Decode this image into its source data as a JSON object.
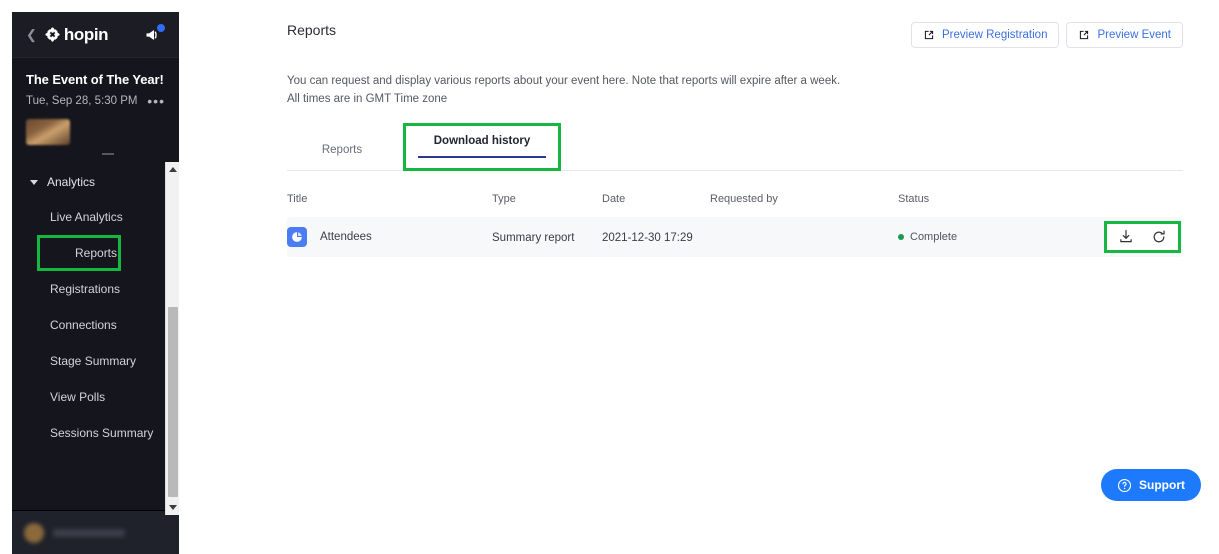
{
  "sidebar": {
    "back_icon": "chevron-left-icon",
    "brand": "hopin",
    "notification_icon": "megaphone-icon",
    "event": {
      "title": "The Event of The Year!",
      "datetime": "Tue, Sep 28, 5:30 PM",
      "more_label": "•••"
    },
    "nav_group": {
      "label": "Analytics",
      "expanded": true
    },
    "items": [
      {
        "label": "Live Analytics",
        "highlighted": false
      },
      {
        "label": "Reports",
        "highlighted": true
      },
      {
        "label": "Registrations",
        "highlighted": false
      },
      {
        "label": "Connections",
        "highlighted": false
      },
      {
        "label": "Stage Summary",
        "highlighted": false
      },
      {
        "label": "View Polls",
        "highlighted": false
      },
      {
        "label": "Sessions Summary",
        "highlighted": false
      }
    ]
  },
  "header": {
    "title": "Reports",
    "buttons": [
      {
        "label": "Preview Registration",
        "icon": "external-link-icon"
      },
      {
        "label": "Preview Event",
        "icon": "external-link-icon"
      }
    ]
  },
  "description": {
    "line1": "You can request and display various reports about your event here. Note that reports will expire after a week.",
    "line2": "All times are in GMT Time zone"
  },
  "tabs": [
    {
      "label": "Reports",
      "active": false
    },
    {
      "label": "Download history",
      "active": true
    }
  ],
  "table": {
    "columns": [
      "Title",
      "Type",
      "Date",
      "Requested by",
      "Status"
    ],
    "rows": [
      {
        "icon": "pie-chart-icon",
        "title": "Attendees",
        "type": "Summary report",
        "date": "2021-12-30 17:29",
        "requested_by": "",
        "status": "Complete",
        "actions": [
          "download-icon",
          "refresh-icon"
        ]
      }
    ]
  },
  "support": {
    "label": "Support",
    "icon": "question-circle-icon"
  },
  "colors": {
    "annotation_green": "#16b741",
    "accent_blue": "#1d7afc",
    "link_blue": "#3b6fe0",
    "status_green": "#1c9a55",
    "sidebar_bg": "#15161d",
    "tab_underline": "#2b3a8f"
  }
}
